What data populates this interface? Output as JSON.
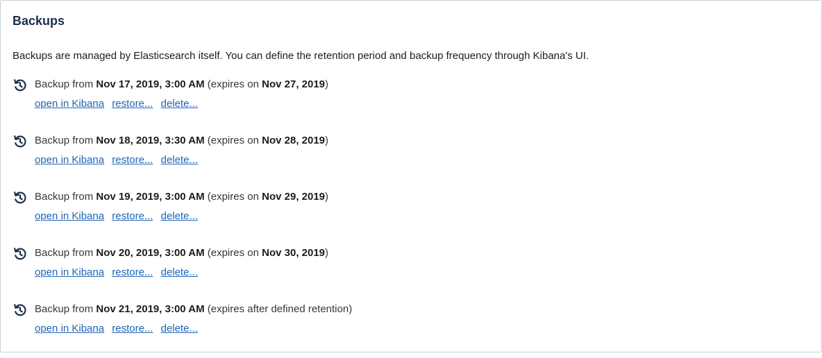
{
  "panel": {
    "title": "Backups",
    "description": "Backups are managed by Elasticsearch itself. You can define the retention period and backup frequency through Kibana's UI."
  },
  "backups": [
    {
      "prefix": "Backup from ",
      "date": "Nov 17, 2019, 3:00 AM",
      "expires_prefix": " (expires on ",
      "expires_date": "Nov 27, 2019",
      "expires_suffix": ")"
    },
    {
      "prefix": "Backup from ",
      "date": "Nov 18, 2019, 3:30 AM",
      "expires_prefix": " (expires on ",
      "expires_date": "Nov 28, 2019",
      "expires_suffix": ")"
    },
    {
      "prefix": "Backup from ",
      "date": "Nov 19, 2019, 3:00 AM",
      "expires_prefix": " (expires on ",
      "expires_date": "Nov 29, 2019",
      "expires_suffix": ")"
    },
    {
      "prefix": "Backup from ",
      "date": "Nov 20, 2019, 3:00 AM",
      "expires_prefix": " (expires on ",
      "expires_date": "Nov 30, 2019",
      "expires_suffix": ")"
    },
    {
      "prefix": "Backup from ",
      "date": "Nov 21, 2019, 3:00 AM",
      "expires_prefix": " (expires after defined retention)",
      "expires_date": "",
      "expires_suffix": ""
    }
  ],
  "actions": {
    "open_label": "open in Kibana",
    "restore_label": "restore...",
    "delete_label": "delete..."
  },
  "icons": {
    "backup": "history-icon"
  },
  "colors": {
    "title": "#1b2f48",
    "link": "#1f64b5",
    "text": "#343741",
    "border": "#c8cdd2"
  }
}
